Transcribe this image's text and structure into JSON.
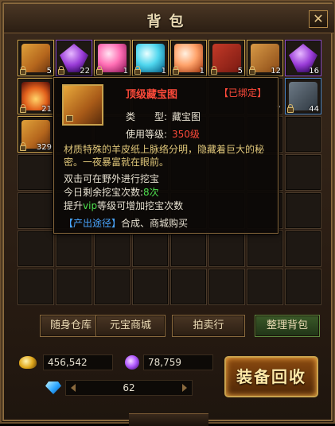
{
  "window": {
    "title": "背包",
    "close_label": "✕"
  },
  "grid": {
    "rows": 7,
    "cols": 8,
    "slots": [
      {
        "icon": "scroll-icon",
        "qty": "5",
        "locked": true,
        "border": "gold"
      },
      {
        "icon": "purple-gem-icon",
        "qty": "22",
        "locked": true,
        "border": "purple"
      },
      {
        "icon": "pink-orb-icon",
        "qty": "1",
        "locked": true,
        "border": "gold"
      },
      {
        "icon": "cyan-orb-icon",
        "qty": "1",
        "locked": true,
        "border": "gold"
      },
      {
        "icon": "peach-orb-icon",
        "qty": "1",
        "locked": true,
        "border": "gold"
      },
      {
        "icon": "red-box-icon",
        "qty": "5",
        "locked": true,
        "border": "gold"
      },
      {
        "icon": "note-icon",
        "qty": "12",
        "locked": true,
        "border": "gold"
      },
      {
        "icon": "purple-gem-icon",
        "qty": "16",
        "locked": false,
        "border": "purple"
      },
      {
        "icon": "fire-icon",
        "qty": "21",
        "locked": true,
        "border": "gold"
      },
      {
        "icon": "",
        "qty": "",
        "locked": false,
        "border": ""
      },
      {
        "icon": "",
        "qty": "",
        "locked": false,
        "border": ""
      },
      {
        "icon": "",
        "qty": "",
        "locked": false,
        "border": ""
      },
      {
        "icon": "",
        "qty": "",
        "locked": false,
        "border": ""
      },
      {
        "icon": "",
        "qty": "",
        "locked": false,
        "border": ""
      },
      {
        "icon": "",
        "qty": "7",
        "locked": false,
        "border": ""
      },
      {
        "icon": "stone-icon",
        "qty": "44",
        "locked": true,
        "border": "blue"
      },
      {
        "icon": "scroll-icon",
        "qty": "329",
        "locked": true,
        "border": "gold"
      }
    ]
  },
  "tooltip": {
    "name": "顶级藏宝图",
    "bound": "【已绑定】",
    "type_label": "类　　型:",
    "type_value": "藏宝图",
    "level_label": "使用等级:",
    "level_value": "350级",
    "description": "材质特殊的羊皮纸上脉络分明，隐藏着巨大的秘密。一夜暴富就在眼前。",
    "line1": "双击可在野外进行挖宝",
    "line2_prefix": "今日剩余挖宝次数:",
    "line2_value": "8次",
    "line3_prefix": "提升",
    "line3_vip": "vip",
    "line3_suffix": "等级可增加挖宝次数",
    "source_label": "【产出途径】",
    "source_value": "合成、商城购买"
  },
  "buttons": {
    "warehouse": "随身仓库",
    "shop": "元宝商城",
    "auction": "拍卖行",
    "sort": "整理背包",
    "recycle": "装备回收"
  },
  "currency": {
    "gold": "456,542",
    "soul": "78,759",
    "diamond": "62"
  }
}
